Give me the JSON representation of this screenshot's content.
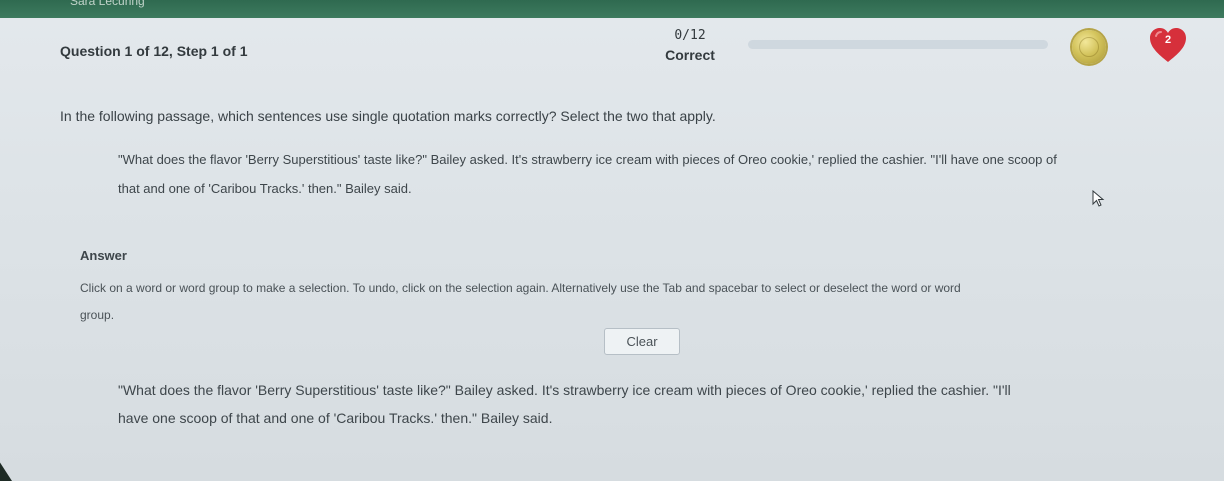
{
  "browser": {
    "tab_title": "Sara Lecuring"
  },
  "header": {
    "question_label": "Question 1 of 12, Step 1 of 1",
    "progress_count": "0/12",
    "progress_status": "Correct",
    "progress_fraction": 0.0,
    "hearts_count": "2",
    "colors": {
      "progress_fill": "#3d8b5f",
      "heart": "#d6303b",
      "coin": "#d2c25a"
    },
    "icons": [
      "coin-icon",
      "heart-icon"
    ]
  },
  "question": {
    "prompt": "In the following passage, which sentences use single quotation marks correctly? Select the two that apply.",
    "passage_line_1": "\"What does the flavor 'Berry Superstitious' taste like?\" Bailey asked. It's strawberry ice cream with pieces of Oreo cookie,' replied the cashier. \"I'll have one scoop of",
    "passage_line_2": "that and one of 'Caribou Tracks.' then.\" Bailey said."
  },
  "answer": {
    "heading": "Answer",
    "instructions_line_1": "Click on a word or word group to make a selection. To undo, click on the selection again. Alternatively use the Tab and spacebar to select or deselect the word or word",
    "instructions_line_2": "group.",
    "clear_label": "Clear",
    "selectable_line_1": "\"What does the flavor 'Berry Superstitious' taste like?\" Bailey asked. It's strawberry ice cream with pieces of Oreo cookie,' replied the cashier. \"I'll",
    "selectable_line_2": "have one scoop of that and one of 'Caribou Tracks.' then.\" Bailey said."
  }
}
